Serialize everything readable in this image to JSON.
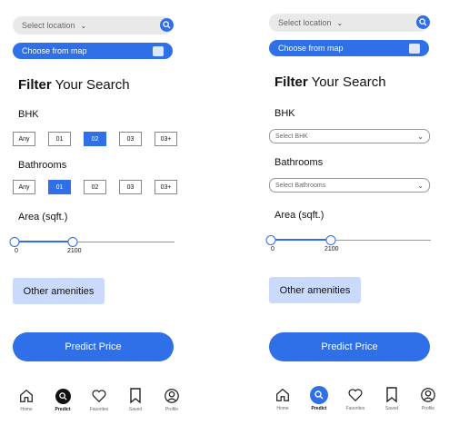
{
  "screens": [
    {
      "location": {
        "placeholder": "Select location",
        "map_label": "Choose from map"
      },
      "title_bold": "Filter",
      "title_rest": " Your Search",
      "bhk": {
        "label": "BHK",
        "options": [
          "Any",
          "01",
          "02",
          "03",
          "03+"
        ],
        "selected": "02"
      },
      "bathrooms": {
        "label": "Bathrooms",
        "options": [
          "Any",
          "01",
          "02",
          "03",
          "03+"
        ],
        "selected": "01"
      },
      "area": {
        "label": "Area (sqft.)",
        "min": "0",
        "max": "2100"
      },
      "amenities": "Other amenities",
      "predict": "Predict Price",
      "nav": [
        "Home",
        "Predict",
        "Favorites",
        "Saved",
        "Profile"
      ]
    },
    {
      "location": {
        "placeholder": "Select location",
        "map_label": "Choose from map"
      },
      "title_bold": "Filter",
      "title_rest": " Your Search",
      "bhk": {
        "label": "BHK",
        "select_placeholder": "Select BHK"
      },
      "bathrooms": {
        "label": "Bathrooms",
        "select_placeholder": "Select Bathrooms"
      },
      "area": {
        "label": "Area (sqft.)",
        "min": "0",
        "max": "2100"
      },
      "amenities": "Other amenities",
      "predict": "Predict Price",
      "nav": [
        "Home",
        "Predict",
        "Favorites",
        "Saved",
        "Profile"
      ]
    }
  ],
  "colors": {
    "accent": "#2f6fe8",
    "light_accent": "#c9dafc"
  }
}
